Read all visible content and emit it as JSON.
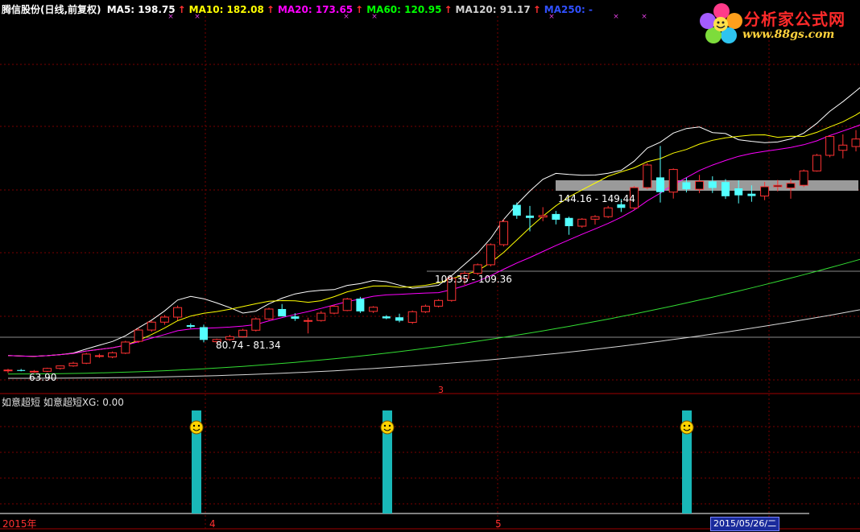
{
  "header": {
    "stock": "腾信股份(日线,前复权)",
    "ma": [
      {
        "label": "MA5: 198.75",
        "color": "#ffffff"
      },
      {
        "label": "MA10: 182.08",
        "color": "#ffff00"
      },
      {
        "label": "MA20: 173.65",
        "color": "#ff00ff"
      },
      {
        "label": "MA60: 120.95",
        "color": "#00ff00"
      },
      {
        "label": "MA120: 91.17",
        "color": "#d0d0d0"
      },
      {
        "label": "MA250: -",
        "color": "#3050ff"
      }
    ],
    "arrow": "↑"
  },
  "logo": {
    "title": "分析家公式网",
    "url": "www.88gs.com"
  },
  "sub_header": {
    "label": "如意超短  如意超短XG: 0.00"
  },
  "axis": {
    "labels": [
      "2015年",
      "4",
      "5"
    ],
    "date_tag": "2015/05/26/二",
    "marker": "3"
  },
  "chart_data": {
    "type": "candlestick",
    "price_range": [
      54,
      200
    ],
    "candles": [
      [
        64.2,
        65.3,
        62.9,
        64.6
      ],
      [
        64.6,
        65.2,
        63.9,
        64.1
      ],
      [
        63.9,
        64.6,
        63.1,
        63.9
      ],
      [
        63.9,
        65.9,
        63.4,
        65.5
      ],
      [
        65.5,
        67.1,
        64.9,
        66.9
      ],
      [
        66.9,
        69.2,
        66.4,
        68.4
      ],
      [
        68.4,
        74.2,
        67.9,
        73.5
      ],
      [
        72.5,
        73.7,
        71.4,
        72.6
      ],
      [
        71.9,
        74.9,
        71.2,
        74.2
      ],
      [
        74.0,
        80.9,
        73.5,
        80.2
      ],
      [
        80.6,
        88.2,
        79.7,
        86.9
      ],
      [
        86.9,
        92.3,
        85.9,
        91.3
      ],
      [
        91.3,
        95.3,
        89.8,
        94.1
      ],
      [
        94.1,
        100.5,
        92.3,
        99.4
      ],
      [
        89.6,
        90.6,
        87.9,
        88.7
      ],
      [
        88.5,
        89.9,
        80.0,
        81.4
      ],
      [
        80.4,
        82.1,
        79.0,
        81.6
      ],
      [
        81.6,
        84.2,
        80.9,
        83.2
      ],
      [
        83.2,
        87.6,
        82.6,
        86.8
      ],
      [
        86.8,
        93.9,
        86.1,
        93.1
      ],
      [
        93.1,
        99.3,
        92.5,
        98.6
      ],
      [
        98.6,
        101.4,
        94.9,
        94.5
      ],
      [
        94.5,
        96.3,
        92.0,
        93.2
      ],
      [
        91.9,
        93.8,
        85.0,
        92.2
      ],
      [
        92.2,
        97.5,
        91.6,
        96.3
      ],
      [
        96.3,
        100.9,
        95.7,
        100.1
      ],
      [
        97.8,
        104.9,
        97.4,
        104.2
      ],
      [
        104.4,
        105.4,
        96.4,
        97.3
      ],
      [
        97.3,
        100.2,
        96.4,
        99.6
      ],
      [
        94.5,
        95.2,
        92.9,
        93.4
      ],
      [
        94.0,
        96.0,
        91.2,
        92.1
      ],
      [
        91.2,
        97.8,
        90.3,
        97.1
      ],
      [
        97.1,
        101.1,
        96.4,
        100.2
      ],
      [
        100.2,
        104.1,
        99.5,
        103.4
      ],
      [
        103.4,
        116.5,
        102.7,
        115.8
      ],
      [
        115.7,
        119.7,
        112.1,
        118.5
      ],
      [
        118.5,
        124.0,
        117.6,
        123.3
      ],
      [
        123.3,
        135.2,
        122.4,
        134.5
      ],
      [
        134.5,
        148.7,
        133.5,
        147.4
      ],
      [
        156.7,
        158.0,
        148.9,
        150.7
      ],
      [
        150.7,
        156.1,
        141.9,
        149.4
      ],
      [
        149.9,
        155.4,
        147.6,
        150.7
      ],
      [
        151.6,
        153.3,
        145.8,
        148.4
      ],
      [
        149.4,
        150.1,
        140.0,
        144.8
      ],
      [
        144.8,
        149.3,
        143.9,
        148.7
      ],
      [
        148.7,
        151.0,
        145.7,
        150.1
      ],
      [
        150.1,
        156.1,
        149.4,
        155.0
      ],
      [
        157.0,
        160.0,
        152.7,
        155.0
      ],
      [
        155.0,
        167.2,
        154.1,
        166.3
      ],
      [
        166.3,
        180.0,
        165.4,
        178.9
      ],
      [
        172.0,
        189.5,
        158.0,
        163.8
      ],
      [
        163.8,
        177.0,
        160.2,
        176.4
      ],
      [
        169.3,
        171.8,
        163.6,
        165.4
      ],
      [
        165.4,
        173.4,
        163.2,
        169.8
      ],
      [
        169.8,
        172.6,
        163.3,
        166.1
      ],
      [
        169.4,
        171.0,
        160.0,
        161.5
      ],
      [
        165.9,
        170.4,
        157.5,
        162.0
      ],
      [
        162.9,
        167.6,
        158.4,
        161.6
      ],
      [
        161.6,
        169.5,
        159.3,
        166.8
      ],
      [
        166.8,
        170.6,
        164.2,
        167.6
      ],
      [
        166.1,
        171.2,
        160.1,
        168.7
      ],
      [
        167.6,
        176.4,
        166.6,
        175.6
      ],
      [
        175.6,
        185.1,
        175.2,
        184.3
      ],
      [
        184.3,
        195.3,
        183.2,
        194.8
      ],
      [
        187.1,
        196.0,
        182.6,
        190.0
      ],
      [
        189.2,
        198.4,
        186.5,
        193.4
      ],
      [
        193.4,
        205.7,
        192.4,
        200.8
      ],
      [
        201.5,
        201.5,
        201.5,
        201.5
      ],
      [
        203.9,
        205.3,
        202.0,
        203.4
      ],
      [
        203.4,
        205.2,
        202.3,
        203.9
      ],
      [
        201.9,
        202.9,
        200.1,
        200.3
      ],
      [
        200.3,
        205.4,
        199.7,
        203.1
      ],
      [
        202.0,
        203.5,
        197.5,
        198.4
      ],
      [
        198.4,
        200.0,
        196.5,
        197.2
      ],
      [
        197.2,
        203.3,
        196.7,
        202.8
      ],
      [
        194.0,
        195.0,
        187.2,
        187.9
      ],
      [
        187.9,
        195.9,
        187.1,
        194.5
      ],
      [
        194.5,
        202.5,
        193.6,
        201.6
      ],
      [
        201.6,
        203.6,
        195.5,
        196.3
      ],
      [
        196.3,
        210.0,
        195.8,
        209.4
      ],
      [
        209.4,
        213.9,
        208.6,
        212.9
      ],
      [
        212.9,
        213.1,
        206.0,
        207.6
      ],
      [
        207.6,
        212.8,
        206.4,
        212.1
      ],
      [
        212.1,
        216.4,
        211.1,
        215.6
      ],
      [
        215.6,
        218.7,
        214.0,
        218.4
      ],
      [
        218.4,
        234.7,
        217.6,
        229.7
      ]
    ],
    "price_labels": [
      "63.90",
      "80.74 - 81.34",
      "109.35 - 109.36",
      "144.16 - 149.44"
    ],
    "signals": [
      14,
      28,
      50
    ],
    "sub_value": 0.0
  }
}
